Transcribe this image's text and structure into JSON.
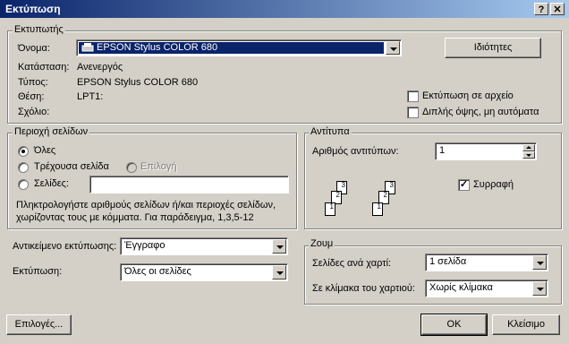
{
  "window": {
    "title": "Εκτύπωση",
    "help_btn": "?",
    "close_btn": "✕"
  },
  "printer": {
    "legend": "Εκτυπωτής",
    "name_label": "Όνομα:",
    "name_value": "EPSON Stylus COLOR 680",
    "properties_btn": "Ιδιότητες",
    "status_label": "Κατάσταση:",
    "status_value": "Ανενεργός",
    "type_label": "Τύπος:",
    "type_value": "EPSON Stylus COLOR 680",
    "where_label": "Θέση:",
    "where_value": "LPT1:",
    "comment_label": "Σχόλιο:",
    "comment_value": "",
    "print_to_file": "Εκτύπωση σε αρχείο",
    "manual_duplex": "Διπλής όψης, μη αυτόματα"
  },
  "page_range": {
    "legend": "Περιοχή σελίδων",
    "all": "Όλες",
    "current": "Τρέχουσα σελίδα",
    "selection": "Επιλογή",
    "pages": "Σελίδες:",
    "pages_value": "",
    "hint": "Πληκτρολογήστε αριθμούς σελίδων ή/και περιοχές σελίδων, χωρίζοντας τους με κόμματα. Για παράδειγμα, 1,3,5-12"
  },
  "copies": {
    "legend": "Αντίτυπα",
    "count_label": "Αριθμός αντιτύπων:",
    "count_value": "1",
    "collate": "Συρραφή",
    "page_digits": [
      "3",
      "2",
      "1",
      "3",
      "2",
      "1"
    ]
  },
  "print_what": {
    "label": "Αντικείμενο εκτύπωσης:",
    "value": "Έγγραφο"
  },
  "print": {
    "label": "Εκτύπωση:",
    "value": "Όλες οι σελίδες"
  },
  "zoom": {
    "legend": "Ζουμ",
    "pps_label": "Σελίδες ανά χαρτί:",
    "pps_value": "1 σελίδα",
    "scale_label": "Σε κλίμακα του χαρτιού:",
    "scale_value": "Χωρίς κλίμακα"
  },
  "buttons": {
    "options": "Επιλογές...",
    "ok": "OK",
    "cancel": "Κλείσιμο"
  }
}
